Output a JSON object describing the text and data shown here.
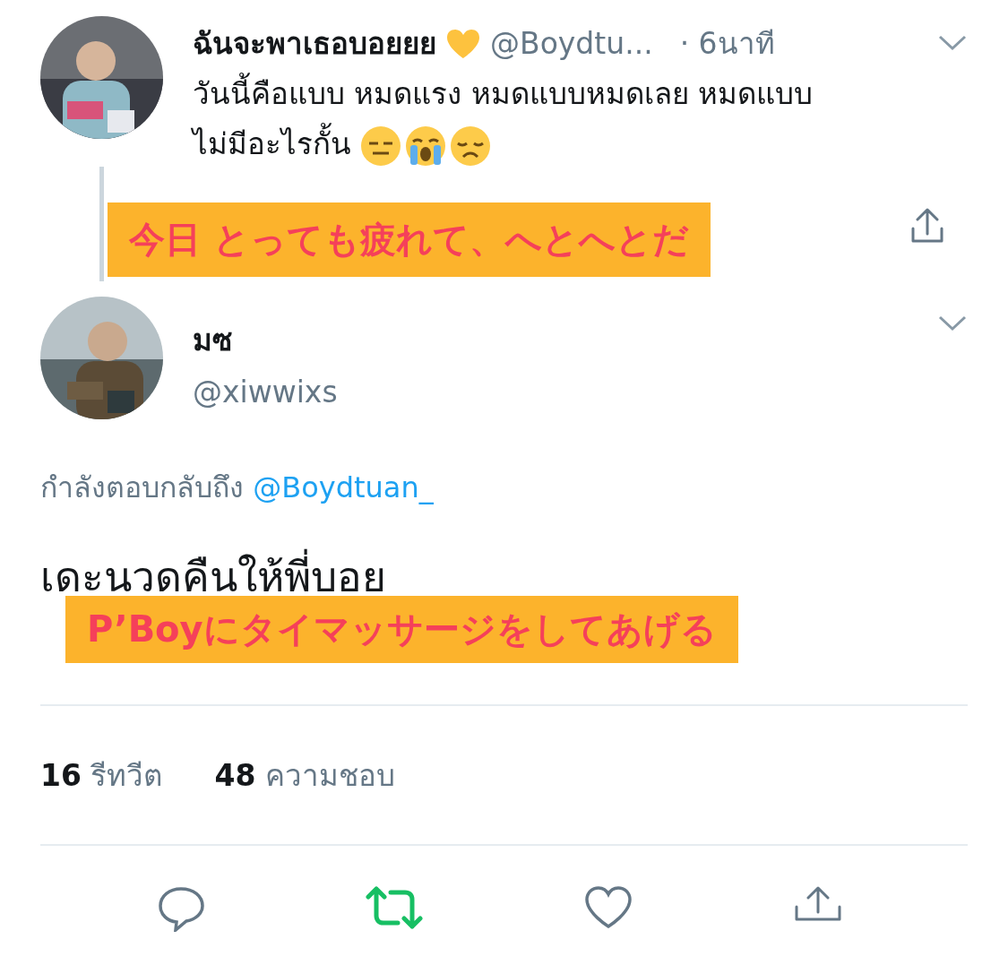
{
  "parent_tweet": {
    "name": "ฉันจะพาเธอบอยยย",
    "handle": "@Boydtu...",
    "time": "· 6นาที",
    "text_lines": [
      "วันนี้คือแบบ หมดแรง หมดแบบหมดเลย หมดแบบ",
      "ไม่มีอะไรกั้น"
    ],
    "caption": "今日 とっても疲れて、へとへとだ"
  },
  "main_tweet": {
    "name": "มซ",
    "handle": "@xiwwixs",
    "reply_prefix": "กำลังตอบกลับถึง",
    "reply_to": "@Boydtuan_",
    "text": "เดะนวดคืนให้พี่บอย",
    "caption": "P’Boyにタイマッサージをしてあげる"
  },
  "stats": [
    {
      "count": "16",
      "label": "รีทวีต"
    },
    {
      "count": "48",
      "label": "ความชอบ"
    }
  ],
  "actions": [
    {
      "kind": "reply",
      "active": false
    },
    {
      "kind": "retweet",
      "active": true
    },
    {
      "kind": "like",
      "active": false
    },
    {
      "kind": "share",
      "active": false
    }
  ]
}
